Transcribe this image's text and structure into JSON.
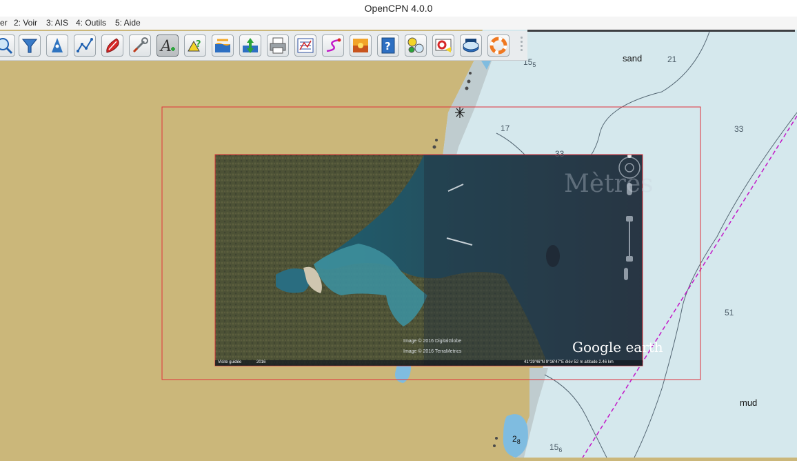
{
  "window": {
    "title": "OpenCPN 4.0.0"
  },
  "menu": {
    "items": [
      {
        "label": "er"
      },
      {
        "label": "2: Voir"
      },
      {
        "label": "3: AIS"
      },
      {
        "label": "4: Outils"
      },
      {
        "label": "5: Aide"
      }
    ]
  },
  "toolbar": {
    "buttons": [
      {
        "icon": "zoom-icon"
      },
      {
        "icon": "funnel-icon"
      },
      {
        "icon": "ship-up-icon"
      },
      {
        "icon": "route-icon"
      },
      {
        "icon": "red-boat-icon"
      },
      {
        "icon": "tools-icon"
      },
      {
        "icon": "text-annotation-icon",
        "active": true
      },
      {
        "icon": "mark-question-icon"
      },
      {
        "icon": "tide-icon"
      },
      {
        "icon": "current-icon"
      },
      {
        "icon": "printer-icon"
      },
      {
        "icon": "route-manager-icon"
      },
      {
        "icon": "track-icon"
      },
      {
        "icon": "sunset-icon"
      },
      {
        "icon": "help-book-icon"
      },
      {
        "icon": "dashboard-icon"
      },
      {
        "icon": "lifebuoy-flag-icon"
      },
      {
        "icon": "grib-icon"
      },
      {
        "icon": "lifebuoy-icon"
      }
    ]
  },
  "chart": {
    "colors": {
      "land": "#cbb77a",
      "shallow": "#bfcccf",
      "water": "#d5e8ed",
      "highlight": "#e0303a",
      "route": "#c218c8"
    },
    "seabed_labels": {
      "sand": "sand",
      "mud": "mud"
    },
    "depths": {
      "d21": "21",
      "d17": "17",
      "d33a": "33",
      "d33b": "33",
      "d51": "51",
      "d15a": "15",
      "d15a_sub": "5",
      "d15b": "15",
      "d15b_sub": "6",
      "d2": "2",
      "d2_sub": "8"
    }
  },
  "overlay": {
    "brand": "Google earth",
    "watermark": "Mètres",
    "image_credits": [
      "Image © 2016 DigitalGlobe",
      "Image © 2016 TerraMetrics"
    ],
    "tour_label": "Visite guidée",
    "year_label": "2016",
    "status_readout": "41°29'46\"N  9°16'47\"E  élév  52 m   altitude  2.46 km"
  }
}
